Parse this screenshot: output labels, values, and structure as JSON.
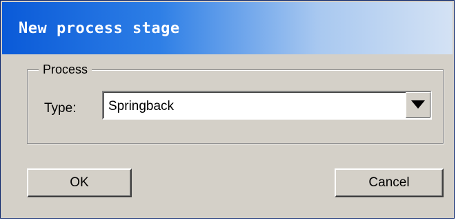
{
  "dialog": {
    "title": "New process stage"
  },
  "process_group": {
    "legend": "Process",
    "type_label": "Type:",
    "type_value": "Springback"
  },
  "buttons": {
    "ok_label": "OK",
    "cancel_label": "Cancel"
  },
  "colors": {
    "titlebar_start": "#0a5ad8",
    "titlebar_end": "#d4e2f4",
    "dialog_face": "#d4d0c8"
  },
  "icons": {
    "dropdown": "chevron-down-icon"
  }
}
